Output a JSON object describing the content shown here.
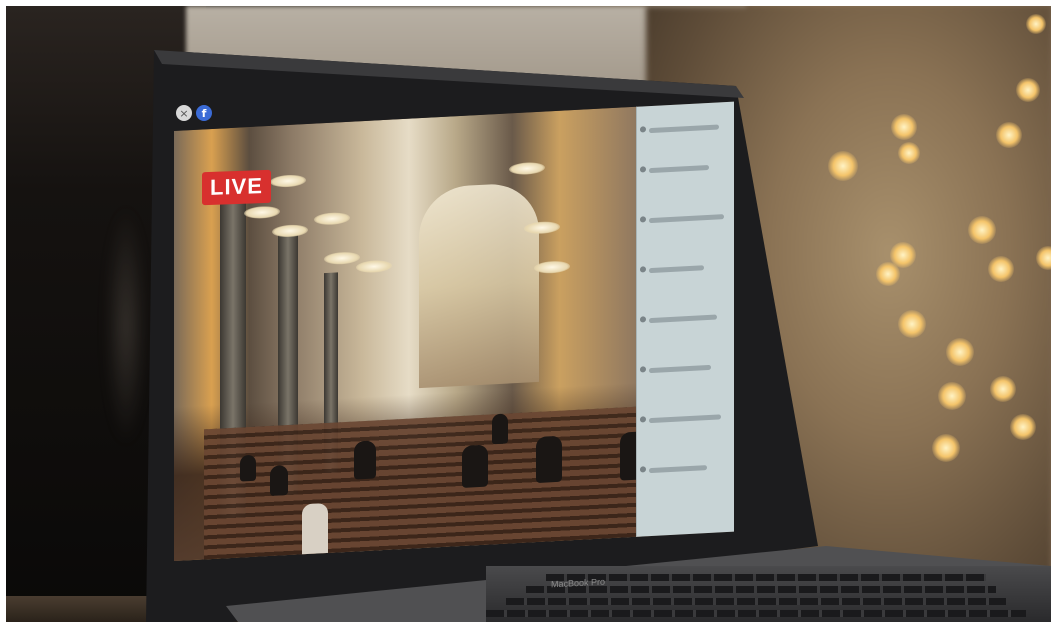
{
  "screen": {
    "live_label": "LIVE",
    "close_icon_glyph": "×",
    "facebook_icon_glyph": "f"
  },
  "laptop": {
    "brand_label": "MacBook Pro"
  },
  "colors": {
    "live_badge": "#d8302e",
    "facebook_blue": "#3b6bd6",
    "bokeh_light": "#f4c46a"
  },
  "icons": [
    "close-icon",
    "facebook-icon"
  ]
}
